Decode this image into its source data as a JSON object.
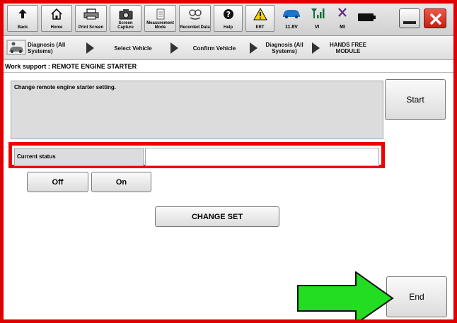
{
  "toolbar": {
    "back": "Back",
    "home": "Home",
    "print_screen": "Print Screen",
    "screen_capture": "Screen Capture",
    "measurement_mode": "Measurement Mode",
    "recorded_data": "Recorded Data",
    "help": "Help",
    "ert": "ERT",
    "battery_voltage": "11.8V",
    "vi": "VI",
    "mi": "MI"
  },
  "breadcrumb": {
    "items": [
      "Diagnosis (All Systems)",
      "Select Vehicle",
      "Confirm Vehicle",
      "Diagnosis (All Systems)",
      "HANDS FREE MODULE"
    ]
  },
  "work_support": {
    "title": "Work support : REMOTE ENGINE STARTER",
    "description": "Change remote engine starter setting.",
    "start_label": "Start",
    "status_label": "Current status",
    "status_value": "",
    "off_label": "Off",
    "on_label": "On",
    "change_set_label": "CHANGE SET",
    "end_label": "End"
  },
  "colors": {
    "highlight_red": "#ee0000",
    "arrow_green": "#22dd22"
  }
}
